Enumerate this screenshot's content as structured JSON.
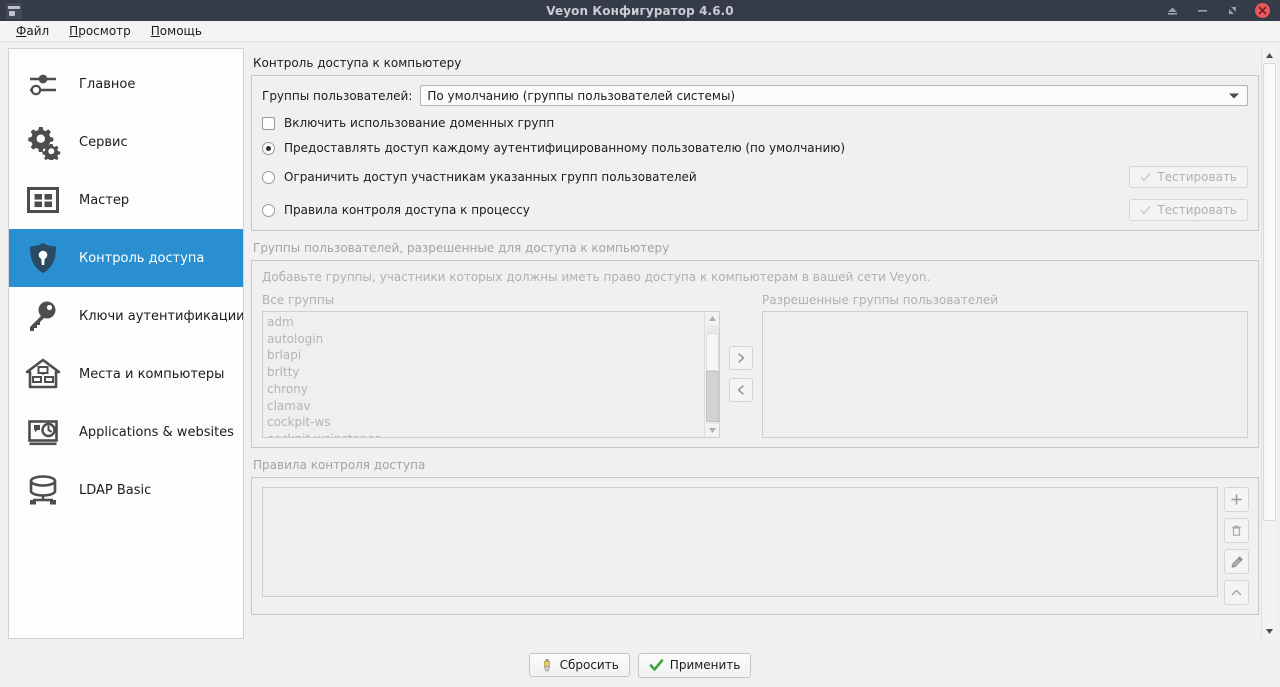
{
  "window": {
    "title": "Veyon Конфигуратор 4.6.0",
    "icon": "veyon-icon",
    "controls": {
      "shade": "shade-button",
      "minimize": "minimize-button",
      "maximize": "maximize-button",
      "close": "close-button"
    },
    "colors": {
      "titlebar": "#353b48",
      "title_text": "#c8ccd4",
      "close": "#e8595f",
      "accent": "#2a8fd0",
      "background": "#f0f0f0",
      "disabled_text": "#b0b0b0"
    }
  },
  "menubar": {
    "items": [
      {
        "label": "Файл",
        "accel": "Ф"
      },
      {
        "label": "Просмотр",
        "accel": "П"
      },
      {
        "label": "Помощь",
        "accel": "П"
      }
    ]
  },
  "sidebar": {
    "items": [
      {
        "label": "Главное",
        "icon": "sliders-icon",
        "selected": false
      },
      {
        "label": "Сервис",
        "icon": "gears-icon",
        "selected": false
      },
      {
        "label": "Мастер",
        "icon": "grid-window-icon",
        "selected": false
      },
      {
        "label": "Контроль доступа",
        "icon": "shield-lock-icon",
        "selected": true
      },
      {
        "label": "Ключи аутентификации",
        "icon": "key-icon",
        "selected": false
      },
      {
        "label": "Места и компьютеры",
        "icon": "house-computers-icon",
        "selected": false
      },
      {
        "label": "Applications & websites",
        "icon": "app-window-clock-icon",
        "selected": false
      },
      {
        "label": "LDAP Basic",
        "icon": "database-icon",
        "selected": false
      }
    ]
  },
  "main": {
    "access_control": {
      "title": "Контроль доступа к компьютеру",
      "user_groups_label": "Группы пользователей:",
      "user_groups_value": "По умолчанию (группы пользователей системы)",
      "domain_groups_checkbox": {
        "label": "Включить использование доменных групп",
        "checked": false
      },
      "options": [
        {
          "label": "Предоставлять доступ каждому аутентифицированному пользователю (по умолчанию)",
          "selected": true,
          "test_button": null
        },
        {
          "label": "Ограничить доступ участникам указанных групп пользователей",
          "selected": false,
          "test_button": "Тестировать"
        },
        {
          "label": "Правила контроля доступа к процессу",
          "selected": false,
          "test_button": "Тестировать"
        }
      ]
    },
    "allowed_groups": {
      "title": "Группы пользователей, разрешенные для доступа к компьютеру",
      "description": "Добавьте группы, участники которых должны иметь право доступа к компьютерам в вашей сети Veyon.",
      "all_groups_label": "Все группы",
      "allowed_groups_label": "Разрешенные группы пользователей",
      "all_groups": [
        "adm",
        "autologin",
        "brlapi",
        "brltty",
        "chrony",
        "clamav",
        "cockpit-ws",
        "cockpit-wsinstance"
      ],
      "allowed_groups": [],
      "add_button": "move-right-button",
      "remove_button": "move-left-button"
    },
    "access_rules": {
      "title": "Правила контроля доступа",
      "rows": [],
      "tools": [
        {
          "name": "add-rule-button",
          "icon": "plus-icon"
        },
        {
          "name": "delete-rule-button",
          "icon": "trash-icon"
        },
        {
          "name": "edit-rule-button",
          "icon": "pencil-icon"
        },
        {
          "name": "move-up-rule-button",
          "icon": "chevron-up-icon"
        }
      ]
    }
  },
  "footer": {
    "reset_label": "Сбросить",
    "reset_icon": "brush-icon",
    "apply_label": "Применить",
    "apply_icon": "check-icon"
  }
}
